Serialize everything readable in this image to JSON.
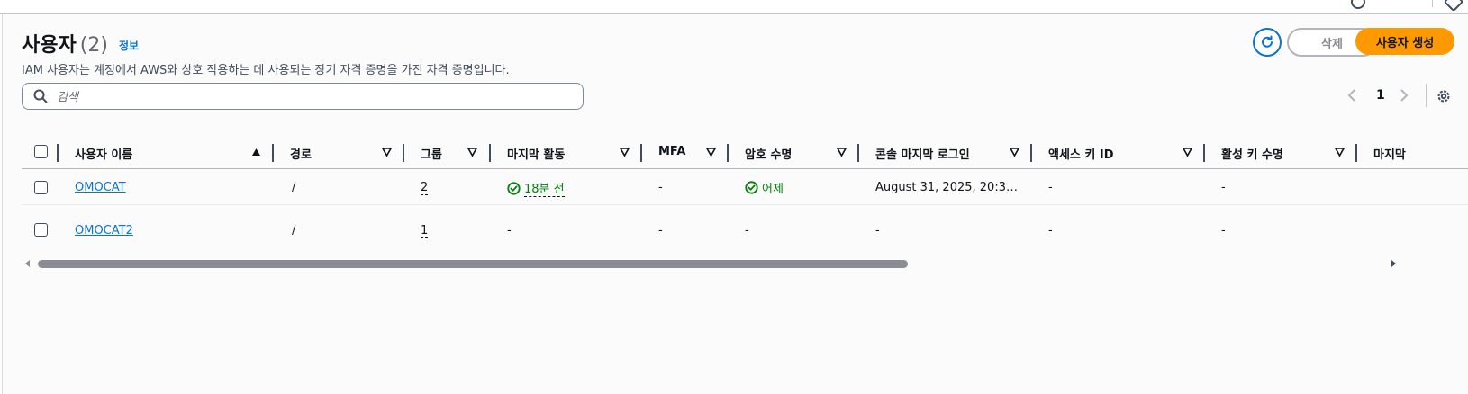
{
  "header": {
    "title": "사용자",
    "count": "(2)",
    "info": "정보",
    "description": "IAM 사용자는 계정에서 AWS와 상호 작용하는 데 사용되는 장기 자격 증명을 가진 자격 증명입니다."
  },
  "actions": {
    "delete_label": "삭제",
    "create_label": "사용자 생성"
  },
  "search": {
    "placeholder": "검색"
  },
  "pagination": {
    "current_page": "1"
  },
  "table": {
    "columns": [
      "사용자 이름",
      "경로",
      "그룹",
      "마지막 활동",
      "MFA",
      "암호 수명",
      "콘솔 마지막 로그인",
      "액세스 키 ID",
      "활성 키 수명",
      "마지막"
    ],
    "rows": [
      {
        "user_name": "OMOCAT",
        "path": "/",
        "groups": "2",
        "last_activity": "18분 전",
        "mfa": "-",
        "password_age": "어제",
        "console_last_login": "August 31, 2025, 20:3…",
        "access_key_id": "-",
        "active_key_age": "-"
      },
      {
        "user_name": "OMOCAT2",
        "path": "/",
        "groups": "1",
        "last_activity": "-",
        "mfa": "-",
        "password_age": "-",
        "console_last_login": "-",
        "access_key_id": "-",
        "active_key_age": "-"
      }
    ]
  },
  "icons": {
    "refresh": "refresh-icon",
    "search": "search-icon",
    "settings": "gear-icon",
    "success": "check-circle-icon"
  },
  "colors": {
    "primary": "#ff9900",
    "link": "#0972d3",
    "success": "#037f0c"
  }
}
